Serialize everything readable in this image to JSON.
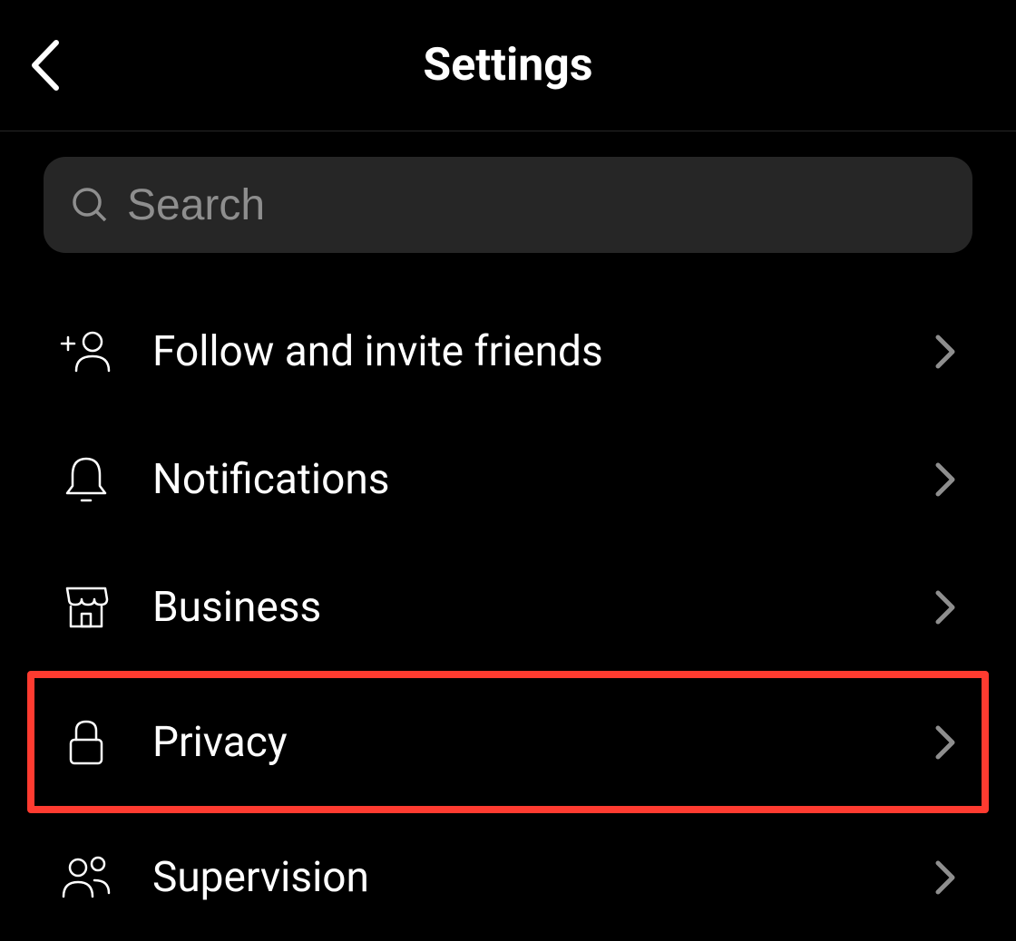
{
  "header": {
    "title": "Settings"
  },
  "search": {
    "placeholder": "Search"
  },
  "menu": {
    "items": [
      {
        "label": "Follow and invite friends",
        "icon": "add-person-icon",
        "highlighted": false
      },
      {
        "label": "Notifications",
        "icon": "bell-icon",
        "highlighted": false
      },
      {
        "label": "Business",
        "icon": "storefront-icon",
        "highlighted": false
      },
      {
        "label": "Privacy",
        "icon": "lock-icon",
        "highlighted": true
      },
      {
        "label": "Supervision",
        "icon": "people-icon",
        "highlighted": false
      }
    ]
  }
}
